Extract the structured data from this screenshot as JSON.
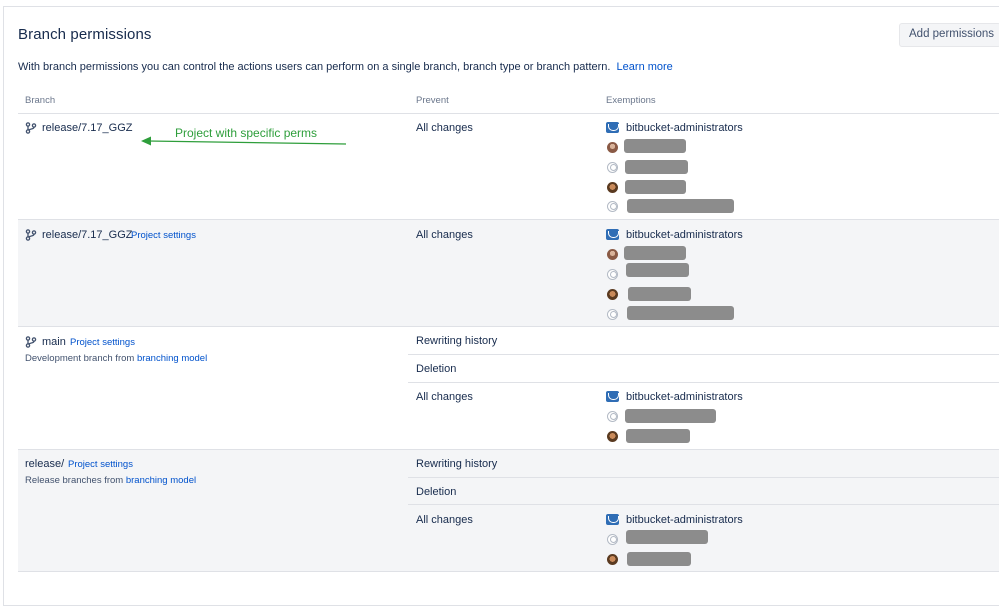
{
  "header": {
    "title": "Branch permissions",
    "add_button": "Add permissions",
    "description": "With branch permissions you can control the actions users can perform on a single branch, branch type or branch pattern.",
    "learn_more": "Learn more"
  },
  "table": {
    "col_branch": "Branch",
    "col_prevent": "Prevent",
    "col_exemptions": "Exemptions"
  },
  "annotation": {
    "text": "Project with specific perms",
    "color": "#2e9e3b"
  },
  "rows": [
    {
      "branch": "release/7.17_GGZ",
      "prevent": "All changes",
      "group": "bitbucket-administrators"
    },
    {
      "branch": "release/7.17_GGZ",
      "project_link": "Project settings",
      "prevent": "All changes",
      "group": "bitbucket-administrators"
    },
    {
      "branch": "main",
      "project_link": "Project settings",
      "desc_prefix": "Development branch from",
      "desc_link": "branching model",
      "prevent": [
        "Rewriting history",
        "Deletion",
        "All changes"
      ],
      "group": "bitbucket-administrators"
    },
    {
      "branch": "release/",
      "project_link": "Project settings",
      "desc_prefix": "Release branches from",
      "desc_link": "branching model",
      "prevent": [
        "Rewriting history",
        "Deletion",
        "All changes"
      ],
      "group": "bitbucket-administrators"
    }
  ],
  "colors": {
    "link": "#0052cc",
    "band": "#f4f5f7",
    "border": "#dfe1e6",
    "group_icon": "#2f6db5"
  }
}
